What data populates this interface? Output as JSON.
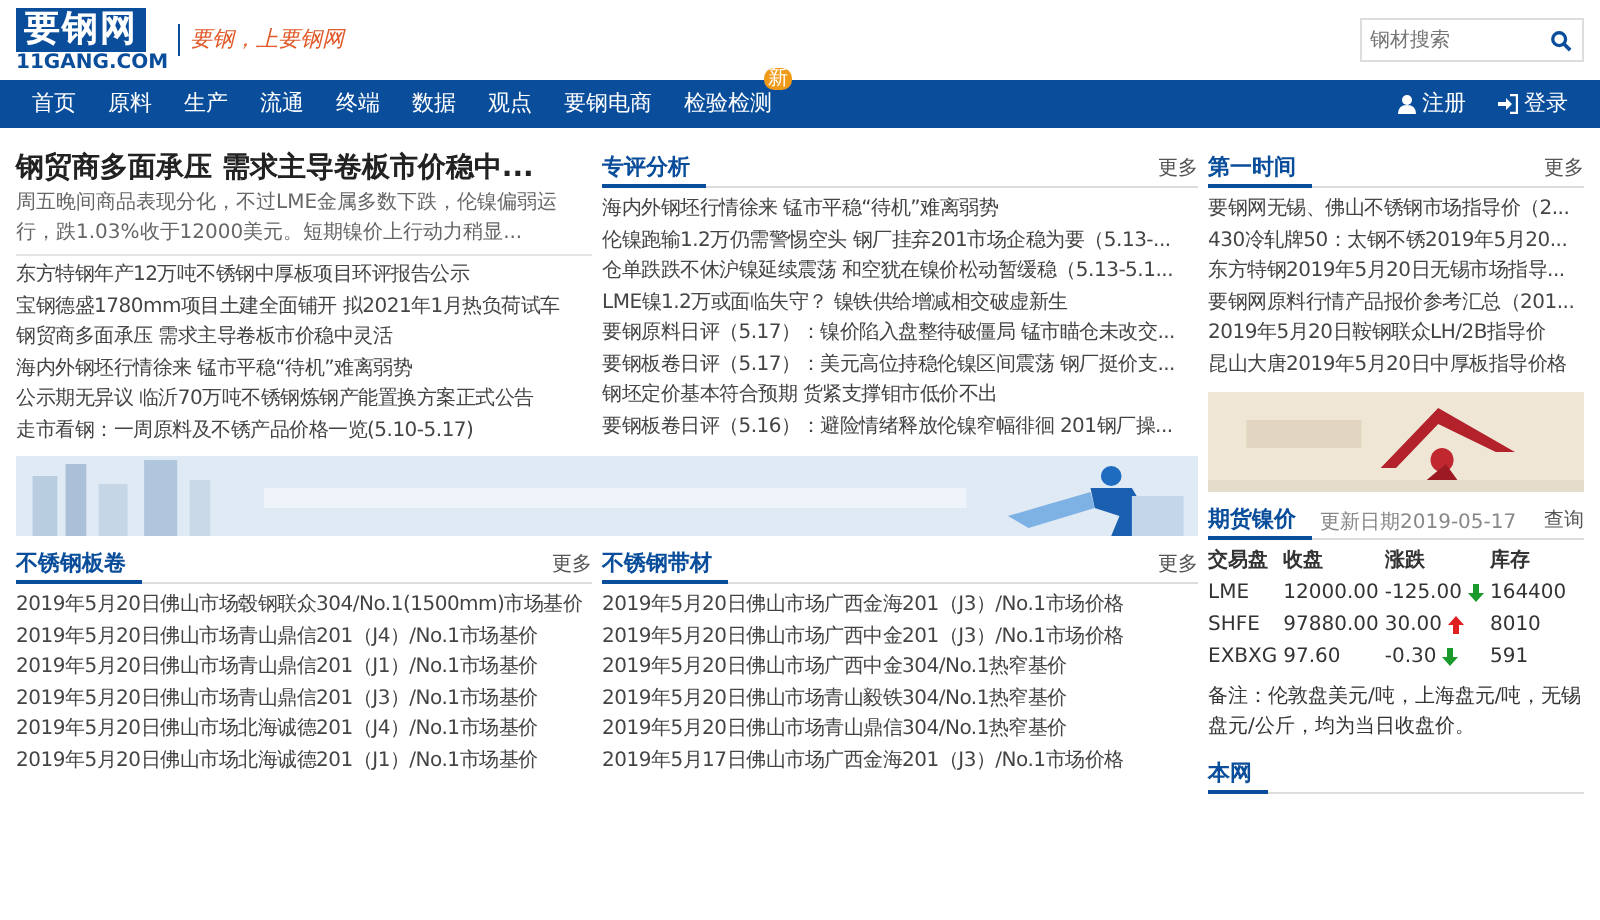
{
  "header": {
    "logo": "要钢网",
    "logo_sub": "11GANG.COM",
    "slogan": "要钢，上要钢网",
    "search": {
      "placeholder": "钢材搜索"
    }
  },
  "nav": {
    "items": [
      {
        "label": "首页"
      },
      {
        "label": "原料"
      },
      {
        "label": "生产"
      },
      {
        "label": "流通"
      },
      {
        "label": "终端"
      },
      {
        "label": "数据"
      },
      {
        "label": "观点"
      },
      {
        "label": "要钢电商"
      },
      {
        "label": "检验检测",
        "badge": "新"
      }
    ],
    "account": [
      {
        "kind": "register",
        "label": "注册"
      },
      {
        "kind": "login",
        "label": "登录"
      }
    ]
  },
  "headline": {
    "title": "钢贸商多面承压 需求主导卷板市价稳中...",
    "summary": "周五晚间商品表现分化，不过LME金属多数下跌，伦镍偏弱运行，跌1.03%收于12000美元。短期镍价上行动力稍显...",
    "items": [
      "东方特钢年产12万吨不锈钢中厚板项目环评报告公示",
      "宝钢德盛1780mm项目土建全面铺开 拟2021年1月热负荷试车",
      "钢贸商多面承压 需求主导卷板市价稳中灵活",
      "海内外钢坯行情徐来 锰市平稳“待机”难离弱势",
      "公示期无异议 临沂70万吨不锈钢炼钢产能置换方案正式公告",
      "走市看钢：一周原料及不锈产品价格一览(5.10-5.17)"
    ]
  },
  "analysis": {
    "title": "专评分析",
    "more": "更多",
    "items": [
      "海内外钢坯行情徐来 锰市平稳“待机”难离弱势",
      "伦镍跑输1.2万仍需警惕空头 钢厂挂弃201市场企稳为要（5.13-...",
      "仓单跌跌不休沪镍延续震荡 和空犹在镍价松动暂缓稳（5.13-5.1...",
      "LME镍1.2万或面临失守？ 镍铁供给增减相交破虚新生",
      "要钢原料日评（5.17）：镍价陷入盘整待破僵局 锰市瞄仓未改交...",
      "要钢板卷日评（5.17）：美元高位持稳伦镍区间震荡 钢厂挺价支...",
      "钢坯定价基本符合预期 货紧支撑钼市低价不出",
      "要钢板卷日评（5.16）：避险情绪释放伦镍窄幅徘徊 201钢厂操..."
    ]
  },
  "first_time": {
    "title": "第一时间",
    "more": "更多",
    "items": [
      "要钢网无锡、佛山不锈钢市场指导价（2...",
      "430冷轧牌50：太钢不锈2019年5月20...",
      "东方特钢2019年5月20日无锡市场指导...",
      "要钢网原料行情产品报价参考汇总（201...",
      "2019年5月20日鞍钢联众LH/2B指导价",
      "昆山大唐2019年5月20日中厚板指导价格"
    ]
  },
  "plates": {
    "title": "不锈钢板卷",
    "more": "更多",
    "items": [
      "2019年5月20日佛山市场毂钢联众304/No.1(1500mm)市场基价",
      "2019年5月20日佛山市场青山鼎信201（J4）/No.1市场基价",
      "2019年5月20日佛山市场青山鼎信201（J1）/No.1市场基价",
      "2019年5月20日佛山市场青山鼎信201（J3）/No.1市场基价",
      "2019年5月20日佛山市场北海诚德201（J4）/No.1市场基价",
      "2019年5月20日佛山市场北海诚德201（J1）/No.1市场基价"
    ]
  },
  "strips": {
    "title": "不锈钢带材",
    "more": "更多",
    "items": [
      "2019年5月20日佛山市场广西金海201（J3）/No.1市场价格",
      "2019年5月20日佛山市场广西中金201（J3）/No.1市场价格",
      "2019年5月20日佛山市场广西中金304/No.1热窄基价",
      "2019年5月20日佛山市场青山毅铁304/No.1热窄基价",
      "2019年5月20日佛山市场青山鼎信304/No.1热窄基价",
      "2019年5月17日佛山市场广西金海201（J3）/No.1市场价格"
    ]
  },
  "futures": {
    "title": "期货镍价",
    "updated": "更新日期2019-05-17",
    "query": "查询",
    "columns": [
      "交易盘",
      "收盘",
      "涨跌",
      "库存"
    ],
    "rows": [
      {
        "market": "LME",
        "close": "12000.00",
        "change": "-125.00",
        "rising": false,
        "stock": "164400"
      },
      {
        "market": "SHFE",
        "close": "97880.00",
        "change": "30.00",
        "rising": true,
        "stock": "8010"
      },
      {
        "market": "EXBXG",
        "close": "97.60",
        "change": "-0.30",
        "rising": false,
        "stock": "591"
      }
    ],
    "note": "备注：伦敦盘美元/吨，上海盘元/吨，无锡盘元/公斤，均为当日收盘价。"
  },
  "site_section": {
    "title": "本网"
  }
}
